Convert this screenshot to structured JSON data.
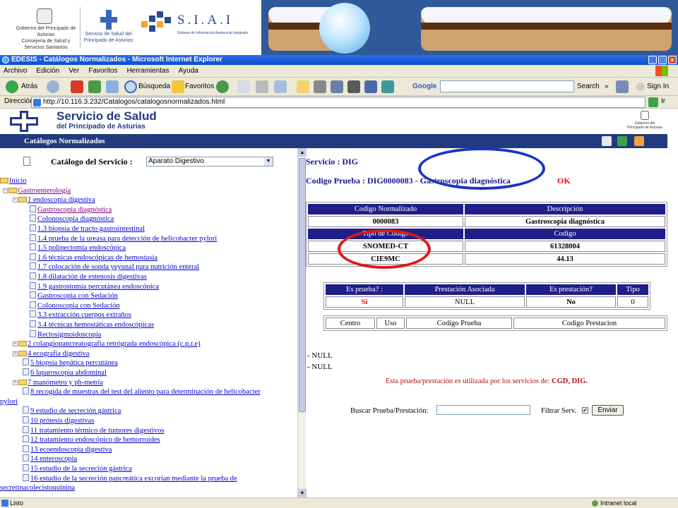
{
  "banner": {
    "gobierno": "Gobierno del Principado de Asturias",
    "consejeria": "Consejería de Salud y Servicios Sanitarios",
    "servicio_salud": "Servicio de Salud del Principado de Asturias",
    "siai_title": "S.I.A.I",
    "siai_subtitle": "Sistema de Información Asistencial Integrado"
  },
  "window": {
    "title": "EDESIS - Catálogos Normalizados - Microsoft Internet Explorer",
    "minimize": "_",
    "maximize": "□",
    "close": "×"
  },
  "menu": [
    "Archivo",
    "Edición",
    "Ver",
    "Favoritos",
    "Herramientas",
    "Ayuda"
  ],
  "toolbar": {
    "back": "Atrás",
    "search": "Búsqueda",
    "favorites": "Favoritos",
    "google": "Google",
    "google_search": "Search",
    "sign_in": "Sign In",
    "more": "»"
  },
  "address": {
    "label": "Dirección",
    "url": "http://10.116.3.232/Catalogos/catalogosnormalizados.html",
    "go": "Ir"
  },
  "site": {
    "title": "Servicio de Salud",
    "subtitle": "del Principado de Asturias",
    "gob_logo": "Gobierno del Principado de Asturias",
    "section": "Catálogos Normalizados"
  },
  "left": {
    "catalog_label": "Catálogo del Servicio :",
    "catalog_selected": "Aparato Digestivo",
    "tree": [
      {
        "text": "Inicio",
        "kind": "folder"
      },
      {
        "text": "Gastroenterologia",
        "kind": "folder"
      },
      {
        "text": "1 endoscopia digestiva",
        "kind": "folder"
      },
      {
        "text": "Gastroscopia diagnóstica",
        "kind": "doc"
      },
      {
        "text": "Colonoscopia diagnóstica",
        "kind": "doc"
      },
      {
        "text": "1.3 biopsia de tracto gastrointestinal",
        "kind": "doc"
      },
      {
        "text": "1.4 prueba de la ureasa para detección de helicobacter pylori",
        "kind": "doc"
      },
      {
        "text": "1.5 polipectomía endoscópica",
        "kind": "doc"
      },
      {
        "text": "1.6 técnicas endoscópicas de hemostasia",
        "kind": "doc"
      },
      {
        "text": "1.7 colocación de sonda yeyunal para nutrición enteral",
        "kind": "doc"
      },
      {
        "text": "1.8 dilatación de estenosis digestivas",
        "kind": "doc"
      },
      {
        "text": "1.9 gastrostomía percutánea endoscópica",
        "kind": "doc"
      },
      {
        "text": "Gastroscopia con Sedación",
        "kind": "doc"
      },
      {
        "text": "Colonoscopia con Sedación",
        "kind": "doc"
      },
      {
        "text": "3.3 extracción cuerpos extraños",
        "kind": "doc"
      },
      {
        "text": "3.4 técnicas hemostáticas endoscópicas",
        "kind": "doc"
      },
      {
        "text": "Rectosigmoidoscopia",
        "kind": "doc"
      },
      {
        "text": "2 colangiopancreatografía retrógrada endoscópica (c.p.r.e)",
        "kind": "folder"
      },
      {
        "text": "4 ecografía digestiva",
        "kind": "folder"
      },
      {
        "text": "5 biopsia hepática percutánea",
        "kind": "doc"
      },
      {
        "text": "6 laparoscopia abdominal",
        "kind": "doc"
      },
      {
        "text": "7 manómetro y ph-metría",
        "kind": "folder"
      },
      {
        "text": "8 recogida de muestras del test del aliento para determinación de helicobacter",
        "kind": "doc"
      },
      {
        "text": "pylori",
        "kind": "cont"
      },
      {
        "text": "9 estudio de secreción gástrica",
        "kind": "doc"
      },
      {
        "text": "10 prótesis digestivas",
        "kind": "doc"
      },
      {
        "text": "11 tratamiento térmico de tumores digestivos",
        "kind": "doc"
      },
      {
        "text": "12 tratamiento endoscópico de hemorroides",
        "kind": "doc"
      },
      {
        "text": "13 ecoendoscopia digestiva",
        "kind": "doc"
      },
      {
        "text": "14 enteroscopia",
        "kind": "doc"
      },
      {
        "text": "15 estudio de la secreción gástrica",
        "kind": "doc"
      },
      {
        "text": "16 estudio de la secreción pancreática excorian mediante la prueba de",
        "kind": "doc"
      },
      {
        "text": "secretinacolecistoquinina",
        "kind": "cont"
      }
    ]
  },
  "right": {
    "servicio": "Servicio : DIG",
    "codigo_prueba": "Codigo Prueba : DIG0000083 - Gastroscopia diagnóstica",
    "ok": "OK",
    "table1": {
      "headers": [
        "Codigo Normalizado",
        "Descripción"
      ],
      "row": [
        "0000083",
        "Gastroscopia diagnóstica"
      ],
      "headers2": [
        "Tipo de Código",
        "Codigo"
      ],
      "rows": [
        [
          "SNOMED-CT",
          "61328004"
        ],
        [
          "CIE9MC",
          "44.13"
        ]
      ]
    },
    "table2": {
      "headers": [
        "Es prueba? :",
        "Prestación Asociada",
        "Es prestación?",
        "Tipo"
      ],
      "row": [
        "Si",
        "NULL",
        "No",
        "0"
      ]
    },
    "table3": {
      "headers": [
        "Centro",
        "Uso",
        "Codigo Prueba",
        "Codigo Prestacion"
      ]
    },
    "null_lines": [
      "- NULL",
      "- NULL"
    ],
    "used_by_text": "Esta prueba/prestación es utilizada por los servicios de:",
    "used_by_services": "CGD, DIG.",
    "search_label": "Buscar Prueba/Prestación:",
    "search_value": "",
    "filter_label": "Filtrar Serv.",
    "filter_check": "✔",
    "send": "Enviar"
  },
  "status": {
    "text": "Listo",
    "zone": "Intranet local"
  }
}
